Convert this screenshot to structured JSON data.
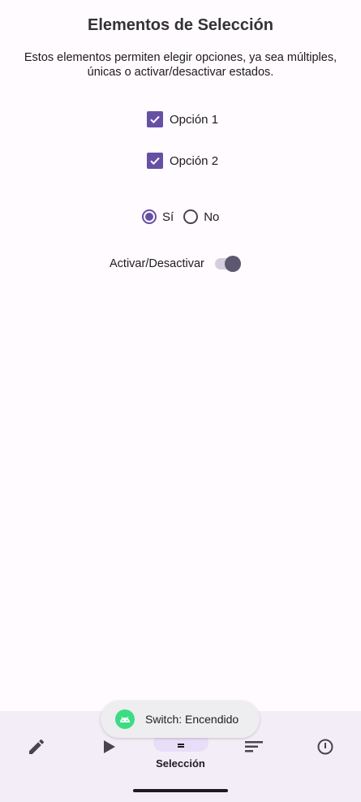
{
  "page": {
    "title": "Elementos de Selección",
    "description": "Estos elementos permiten elegir opciones, ya sea múltiples, únicas o activar/desactivar estados."
  },
  "checkboxes": [
    {
      "label": "Opción 1",
      "checked": true
    },
    {
      "label": "Opción 2",
      "checked": true
    }
  ],
  "radios": [
    {
      "label": "Sí",
      "selected": true
    },
    {
      "label": "No",
      "selected": false
    }
  ],
  "switch": {
    "label": "Activar/Desactivar",
    "on": true
  },
  "toast": {
    "text": "Switch: Encendido",
    "icon": "android-icon"
  },
  "bottom_nav": {
    "items": [
      {
        "icon": "pencil-icon",
        "label": ""
      },
      {
        "icon": "play-icon",
        "label": ""
      },
      {
        "icon": "list-icon",
        "label": "Selección",
        "selected": true
      },
      {
        "icon": "sort-icon",
        "label": ""
      },
      {
        "icon": "info-icon",
        "label": ""
      }
    ]
  },
  "colors": {
    "accent": "#6750a4",
    "background": "#fffbff",
    "nav_background": "#f3edf7",
    "nav_indicator": "#e8def8",
    "switch_thumb": "#5d5772",
    "toast_icon": "#3ddc84"
  }
}
